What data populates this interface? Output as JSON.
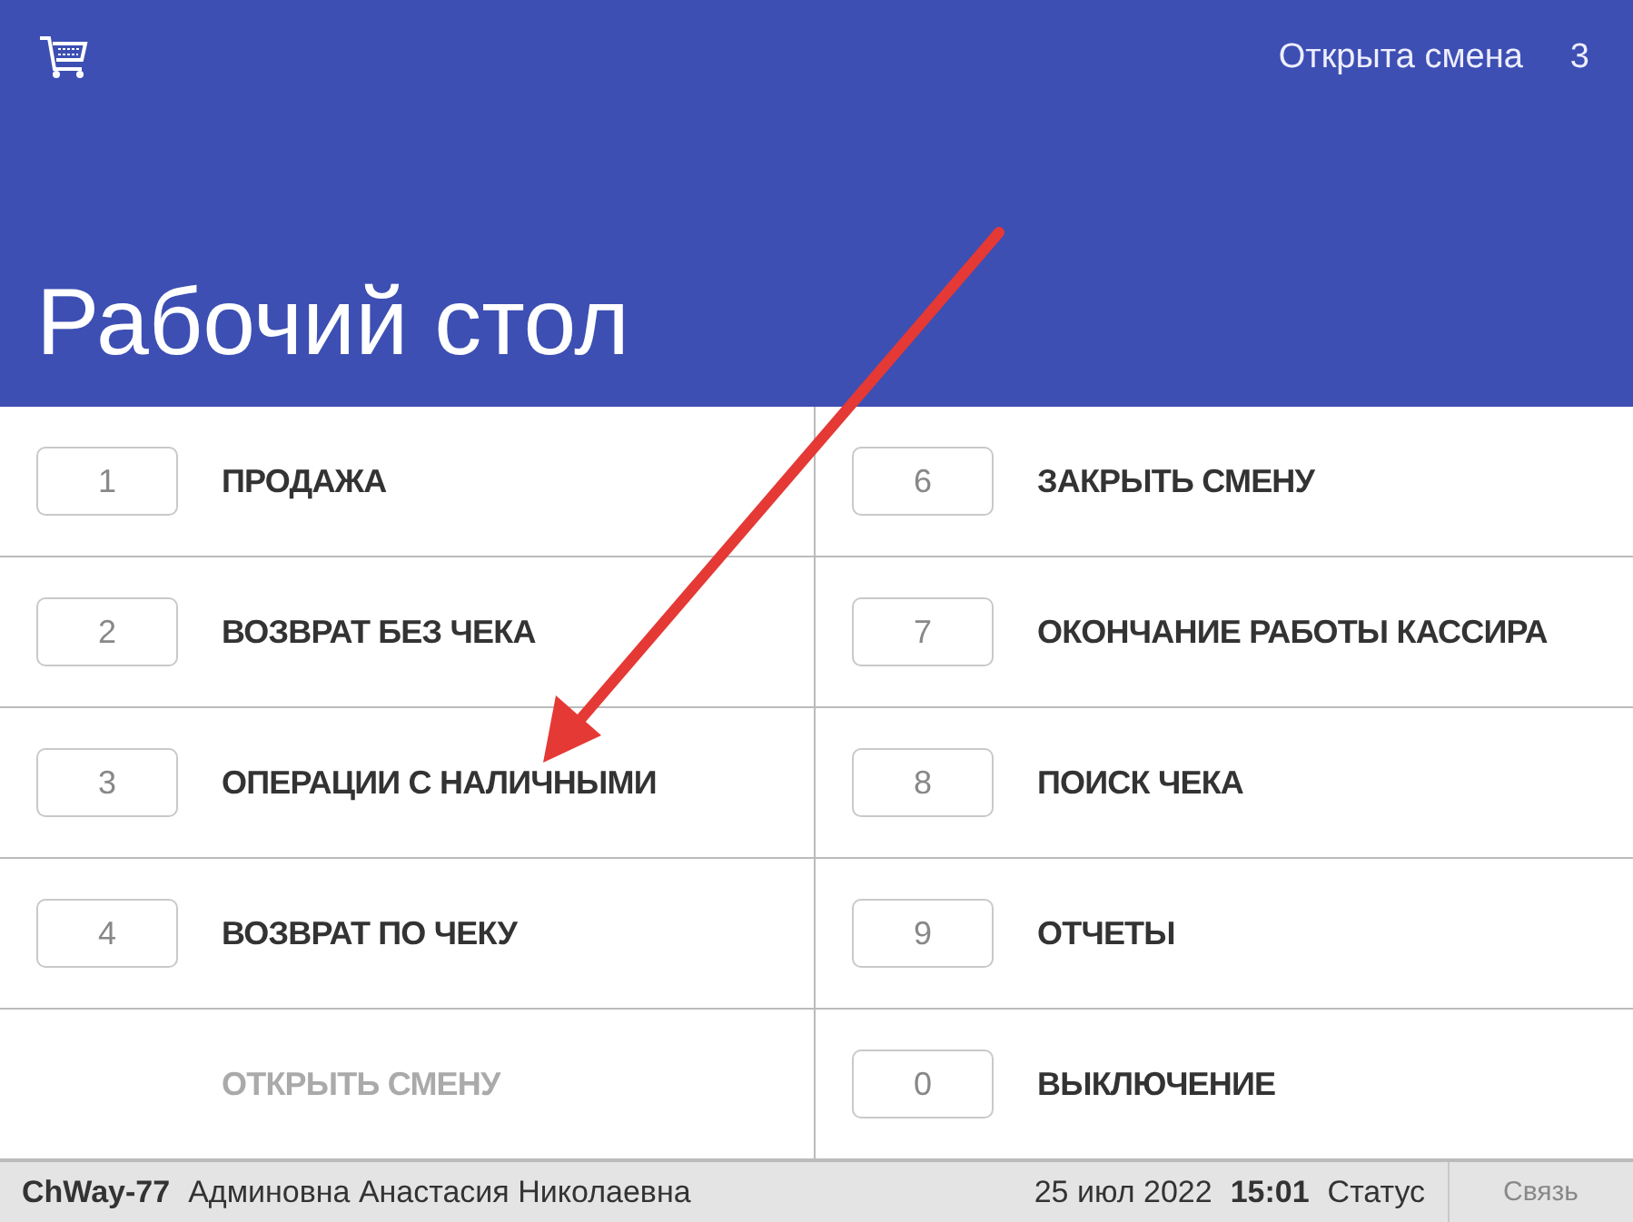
{
  "header": {
    "title": "Рабочий стол",
    "shift_label": "Открыта смена",
    "shift_number": "3"
  },
  "menu": {
    "left": [
      {
        "key": "1",
        "label": "ПРОДАЖА",
        "disabled": false
      },
      {
        "key": "2",
        "label": "ВОЗВРАТ БЕЗ ЧЕКА",
        "disabled": false
      },
      {
        "key": "3",
        "label": "ОПЕРАЦИИ С НАЛИЧНЫМИ",
        "disabled": false
      },
      {
        "key": "4",
        "label": "ВОЗВРАТ ПО ЧЕКУ",
        "disabled": false
      },
      {
        "label": "ОТКРЫТЬ СМЕНУ",
        "disabled": true
      }
    ],
    "right": [
      {
        "key": "6",
        "label": "ЗАКРЫТЬ СМЕНУ",
        "disabled": false
      },
      {
        "key": "7",
        "label": "ОКОНЧАНИЕ РАБОТЫ КАССИРА",
        "disabled": false
      },
      {
        "key": "8",
        "label": "ПОИСК ЧЕКА",
        "disabled": false
      },
      {
        "key": "9",
        "label": "ОТЧЕТЫ",
        "disabled": false
      },
      {
        "key": "0",
        "label": "ВЫКЛЮЧЕНИЕ",
        "disabled": false
      }
    ]
  },
  "status_bar": {
    "terminal": "ChWay-77",
    "user": "Админовна Анастасия Николаевна",
    "date": "25 июл 2022",
    "time": "15:01",
    "status": "Статус",
    "connection": "Связь"
  },
  "annotations": [
    {
      "kind": "arrow",
      "color": "#e53935"
    }
  ]
}
